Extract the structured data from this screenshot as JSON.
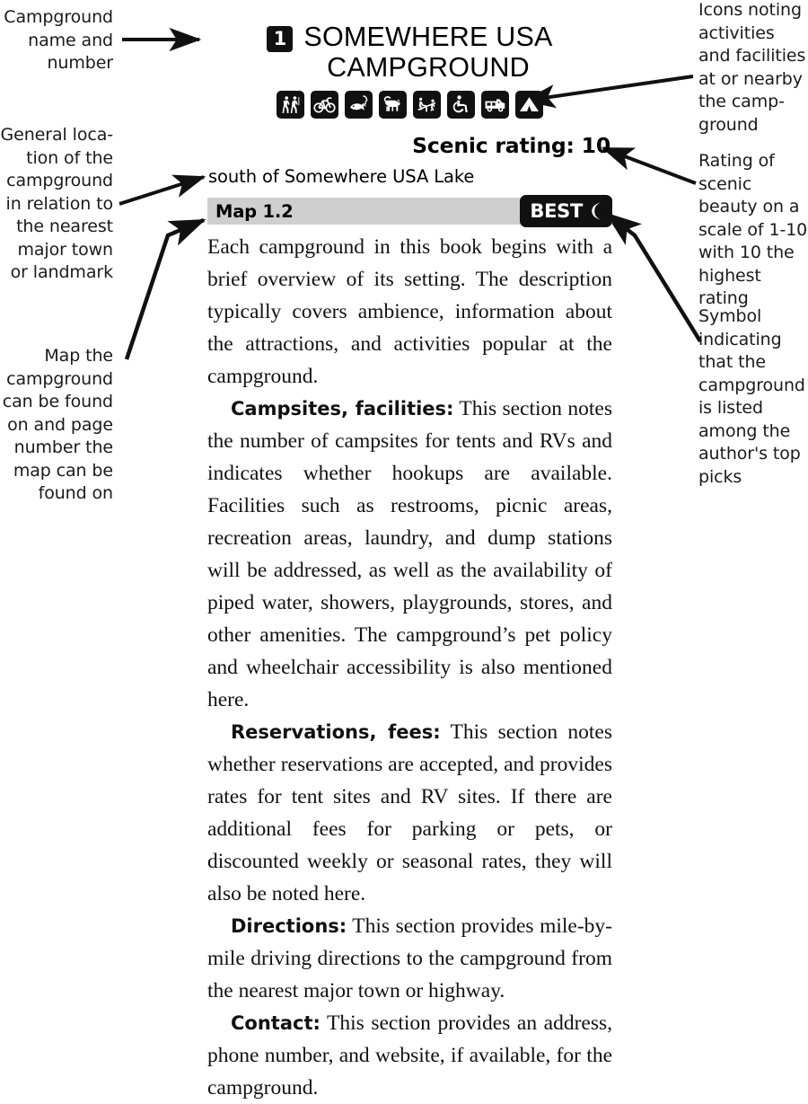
{
  "annotations": {
    "left": [
      {
        "id": "campground-name-and-number",
        "text": "Campground\nname and\nnumber"
      },
      {
        "id": "general-location",
        "text": "General loca-\ntion of the\ncampground\nin relation to\nthe nearest\nmajor town\nor landmark"
      },
      {
        "id": "map-and-page-number",
        "text": "Map the\ncampground\ncan be found\non and page\nnumber the\nmap can be\nfound on"
      }
    ],
    "right": [
      {
        "id": "icons-activities-facilities",
        "text": "Icons noting\nactivities\nand facilities\nat or nearby\nthe camp-\nground"
      },
      {
        "id": "scenic-rating-explanation",
        "text": "Rating of\nscenic beauty\non a scale of\n1-10 with 10\nthe highest\nrating"
      },
      {
        "id": "best-symbol-explanation",
        "text": "Symbol\nindicating\nthat the\ncampground\nis listed\namong the\nauthor's top\npicks"
      }
    ]
  },
  "listing": {
    "number": "1",
    "title": "SOMEWHERE USA\nCAMPGROUND",
    "icons": [
      {
        "name": "hiking-icon",
        "label": "Hiking"
      },
      {
        "name": "biking-icon",
        "label": "Biking"
      },
      {
        "name": "fishing-icon",
        "label": "Fishing"
      },
      {
        "name": "pets-icon",
        "label": "Pets allowed"
      },
      {
        "name": "playground-icon",
        "label": "Playground"
      },
      {
        "name": "wheelchair-accessible-icon",
        "label": "Wheelchair accessible"
      },
      {
        "name": "rv-sites-icon",
        "label": "RV sites"
      },
      {
        "name": "tent-sites-icon",
        "label": "Tent sites"
      }
    ],
    "scenic_rating": "Scenic rating: 10",
    "location": "south of Somewhere USA Lake",
    "map_label": "Map 1.2",
    "best_badge": "BEST",
    "paragraphs": [
      {
        "indent": false,
        "runin": "",
        "text": "Each campground in this book begins with a brief overview of its setting. The description typically covers ambience, information about the attractions, and activities popular at the campground."
      },
      {
        "indent": true,
        "runin": "Campsites, facilities:",
        "text": " This section notes the number of campsites for tents and RVs and indicates whether hookups are available. Facilities such as restrooms, picnic areas, recreation areas, laundry, and dump stations will be addressed, as well as the availability of piped water, showers, playgrounds, stores, and other amenities. The campground’s pet policy and wheelchair accessibility is also mentioned here."
      },
      {
        "indent": true,
        "runin": "Reservations, fees:",
        "text": " This section notes whether reservations are accepted, and provides rates for tent sites and RV sites. If there are additional fees for parking or pets, or discounted weekly or seasonal rates, they will also be noted here."
      },
      {
        "indent": true,
        "runin": "Directions:",
        "text": " This section provides mile-by-mile driving directions to the campground from the nearest major town or highway."
      },
      {
        "indent": true,
        "runin": "Contact:",
        "text": " This section provides an address, phone number, and website, if available, for the campground."
      }
    ]
  },
  "colors": {
    "ink": "#111111",
    "map_bar_gray": "#cfcfcf",
    "page_background": "#ffffff"
  }
}
